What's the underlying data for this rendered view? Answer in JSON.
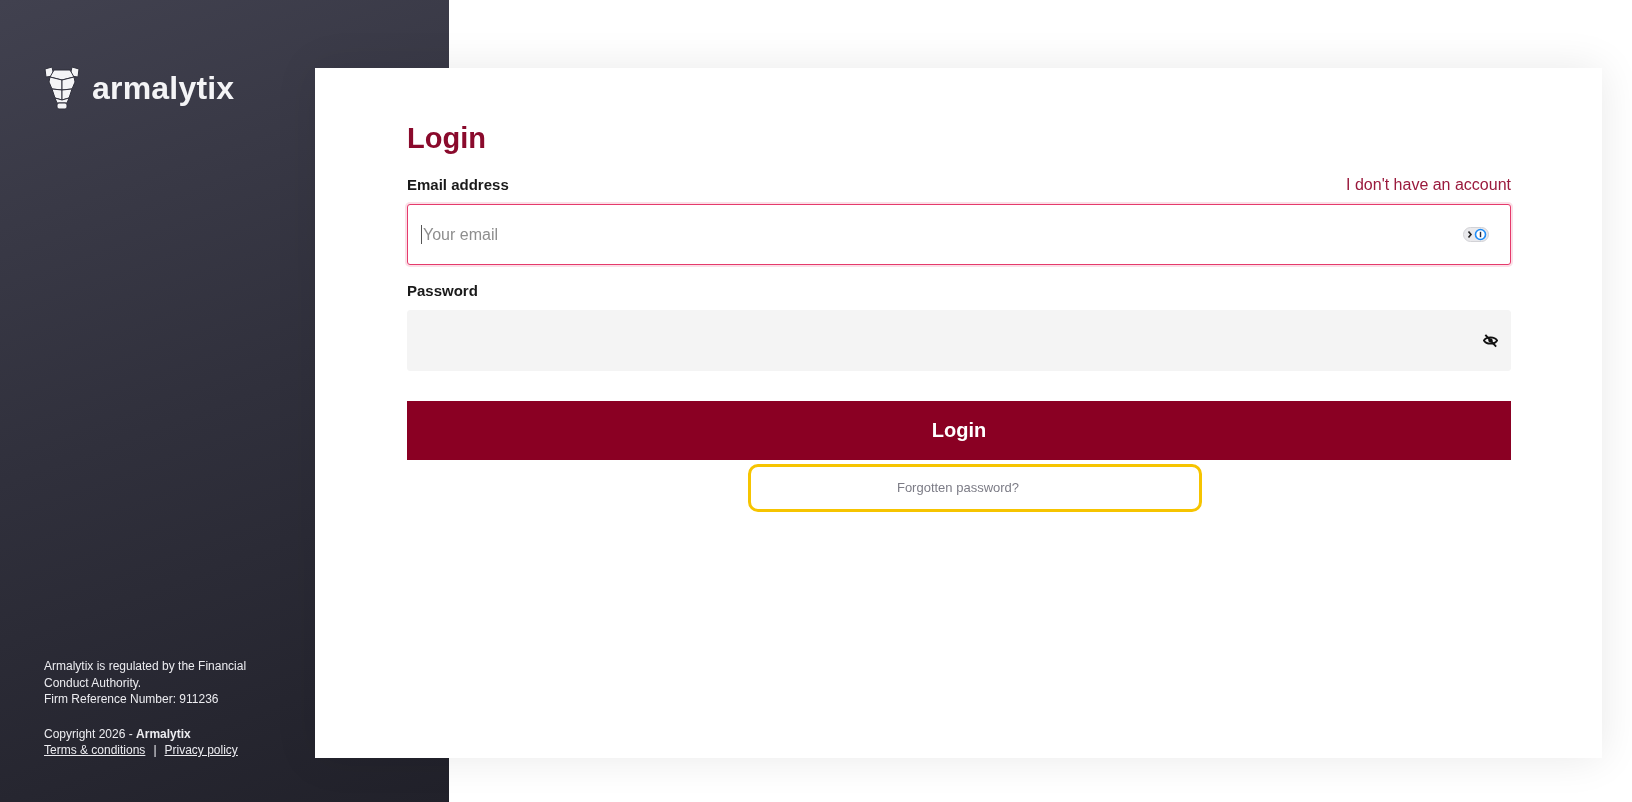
{
  "sidebar": {
    "brand": "armalytix",
    "regulation": "Armalytix is regulated by the Financial Conduct Authority.",
    "reference": "Firm Reference Number: 911236",
    "copyright": "Copyright 2026 - **Armalytix**",
    "links": [
      "Terms & conditions",
      "Privacy policy"
    ],
    "separator": "|"
  },
  "login": {
    "title": "Login",
    "email": {
      "label": "Email address",
      "placeholder": "Your email",
      "focused": true
    },
    "signup_link": "I don't have an account",
    "password": {
      "label": "Password"
    },
    "submit": "Login",
    "forgot": {
      "label": "Forgotten password?",
      "highlighted": true
    }
  }
}
